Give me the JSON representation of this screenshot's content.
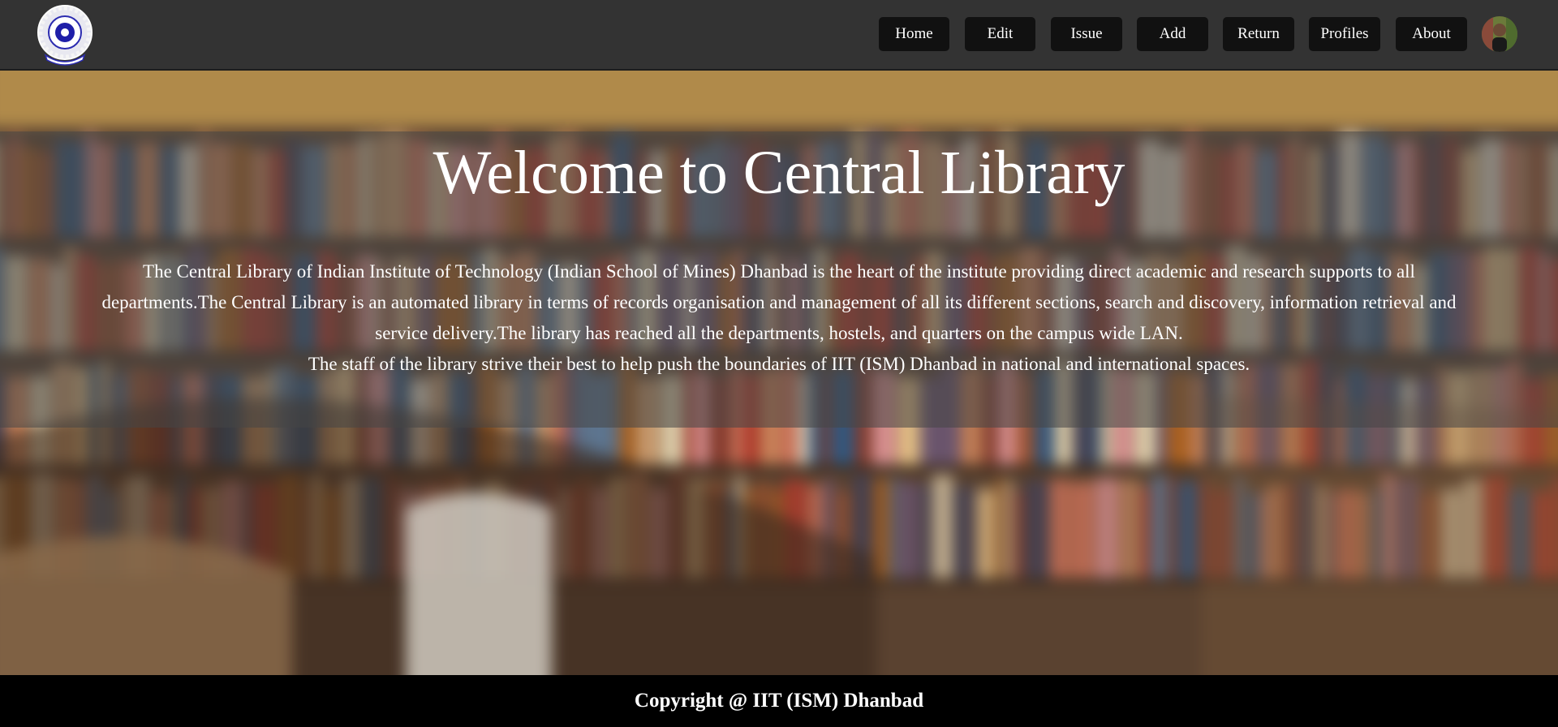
{
  "navbar": {
    "logo_icon": "institute-emblem-icon",
    "items": [
      {
        "label": "Home"
      },
      {
        "label": "Edit"
      },
      {
        "label": "Issue"
      },
      {
        "label": "Add"
      },
      {
        "label": "Return"
      },
      {
        "label": "Profiles"
      },
      {
        "label": "About"
      }
    ],
    "avatar_icon": "user-avatar-icon"
  },
  "hero": {
    "title": "Welcome to Central Library",
    "paragraph_1": "The Central Library of Indian Institute of Technology (Indian School of Mines) Dhanbad is the heart of the institute providing direct academic and research supports to all departments.The Central Library is an automated library in terms of records organisation and management of all its different sections, search and discovery, information retrieval and service delivery.The library has reached all the departments, hostels, and quarters on the campus wide LAN.",
    "paragraph_2": "The staff of the library strive their best to help push the boundaries of IIT (ISM) Dhanbad in national and international spaces."
  },
  "footer": {
    "copyright": "Copyright @ IIT (ISM) Dhanbad"
  },
  "colors": {
    "navbar_bg": "#333333",
    "button_bg": "#111111",
    "footer_bg": "#000000",
    "text": "#ffffff"
  }
}
